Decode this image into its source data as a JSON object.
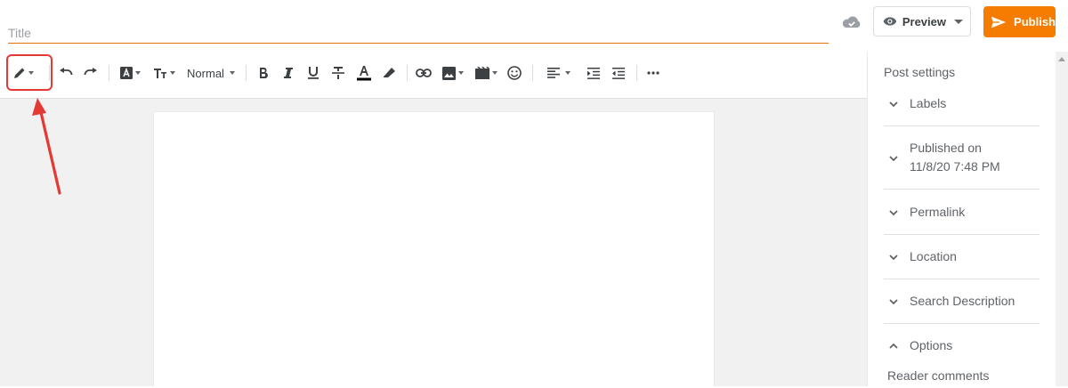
{
  "header": {
    "title_placeholder": "Title",
    "preview_label": "Preview",
    "publish_label": "Publish",
    "accent_color": "#f57c00"
  },
  "toolbar": {
    "font_size_label": "Normal",
    "items": [
      "pencil-mode",
      "undo",
      "redo",
      "font",
      "text-size",
      "paragraph-style",
      "bold",
      "italic",
      "underline",
      "strikethrough",
      "text-color",
      "highlight",
      "link",
      "image",
      "video",
      "emoji",
      "align",
      "indent",
      "outdent",
      "more"
    ]
  },
  "sidebar": {
    "title": "Post settings",
    "sections": [
      {
        "label": "Labels",
        "expanded": false
      },
      {
        "label": "Published on\n11/8/20 7:48 PM",
        "expanded": false
      },
      {
        "label": "Permalink",
        "expanded": false
      },
      {
        "label": "Location",
        "expanded": false
      },
      {
        "label": "Search Description",
        "expanded": false
      },
      {
        "label": "Options",
        "expanded": true
      }
    ],
    "reader_comments": "Reader comments"
  },
  "annotation": {
    "color": "#e53935"
  }
}
